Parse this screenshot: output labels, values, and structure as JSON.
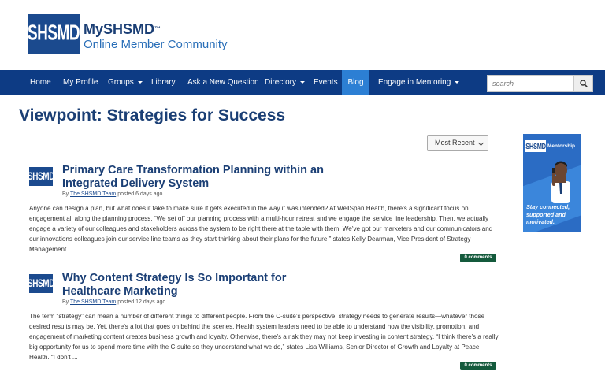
{
  "header": {
    "logo_text": "SHSMD",
    "brand_name": "MySHSMD",
    "brand_mark": "™",
    "brand_sub": "Online Member Community"
  },
  "nav": {
    "items": [
      {
        "label": "Home"
      },
      {
        "label": "My Profile"
      },
      {
        "label": "Groups",
        "dropdown": true
      },
      {
        "label": "Library"
      },
      {
        "label": "Ask a New Question"
      },
      {
        "label": "Directory",
        "dropdown": true
      },
      {
        "label": "Events"
      },
      {
        "label": "Blog",
        "active": true
      },
      {
        "label": "Engage in Mentoring",
        "dropdown": true
      }
    ],
    "search_placeholder": "search",
    "search_icon": "search-icon"
  },
  "page": {
    "title": "Viewpoint: Strategies for Success",
    "sort_selected": "Most Recent"
  },
  "posts": [
    {
      "logo_text": "SHSMD",
      "title": "Primary Care Transformation Planning within an Integrated Delivery System",
      "by": "By",
      "author": "The SHSMD Team",
      "posted": "posted 6 days ago",
      "excerpt": "Anyone can design a plan, but what does it take to make sure it gets executed in the way it was intended? At WellSpan Health, there’s a significant focus on engagement all along the planning process. “We set off our planning process with a multi-hour retreat and we engage the service line leadership. Then, we actually engage a variety of our colleagues and stakeholders across the system to be right there at the table with them. We’ve got our marketers and our communicators and our innovations colleagues join our service line teams as they start thinking about their plans for the future,” states Kelly Dearman, Vice President of Strategy Management. ...",
      "comments": "0 comments"
    },
    {
      "logo_text": "SHSMD",
      "title": "Why Content Strategy Is So Important for Healthcare Marketing",
      "by": "By",
      "author": "The SHSMD Team",
      "posted": "posted 12 days ago",
      "excerpt": "The term “strategy” can mean a number of different things to different people. From the C-suite’s perspective, strategy needs to generate results—whatever those desired results may be. Yet, there’s a lot that goes on behind the scenes. Health system leaders need to be able to understand how the visibility, promotion, and engagement of marketing content creates business growth and loyalty. Otherwise, there’s a risk they may not keep investing in content strategy. “I think there’s a really big opportunity for us to spend more time with the C-suite so they understand what we do,” states Lisa Williams, Senior Director of Growth and Loyalty at Peace Health. “I don’t ...",
      "comments": "0 comments"
    }
  ],
  "sidebar_ad": {
    "logo_text": "SHSMD",
    "heading": "Mentorship",
    "tagline": "Stay connected, supported and motivated."
  },
  "colors": {
    "nav_bg": "#0d3b84",
    "nav_active": "#2c7fd4",
    "title": "#1b3f75",
    "badge": "#145a3c"
  }
}
